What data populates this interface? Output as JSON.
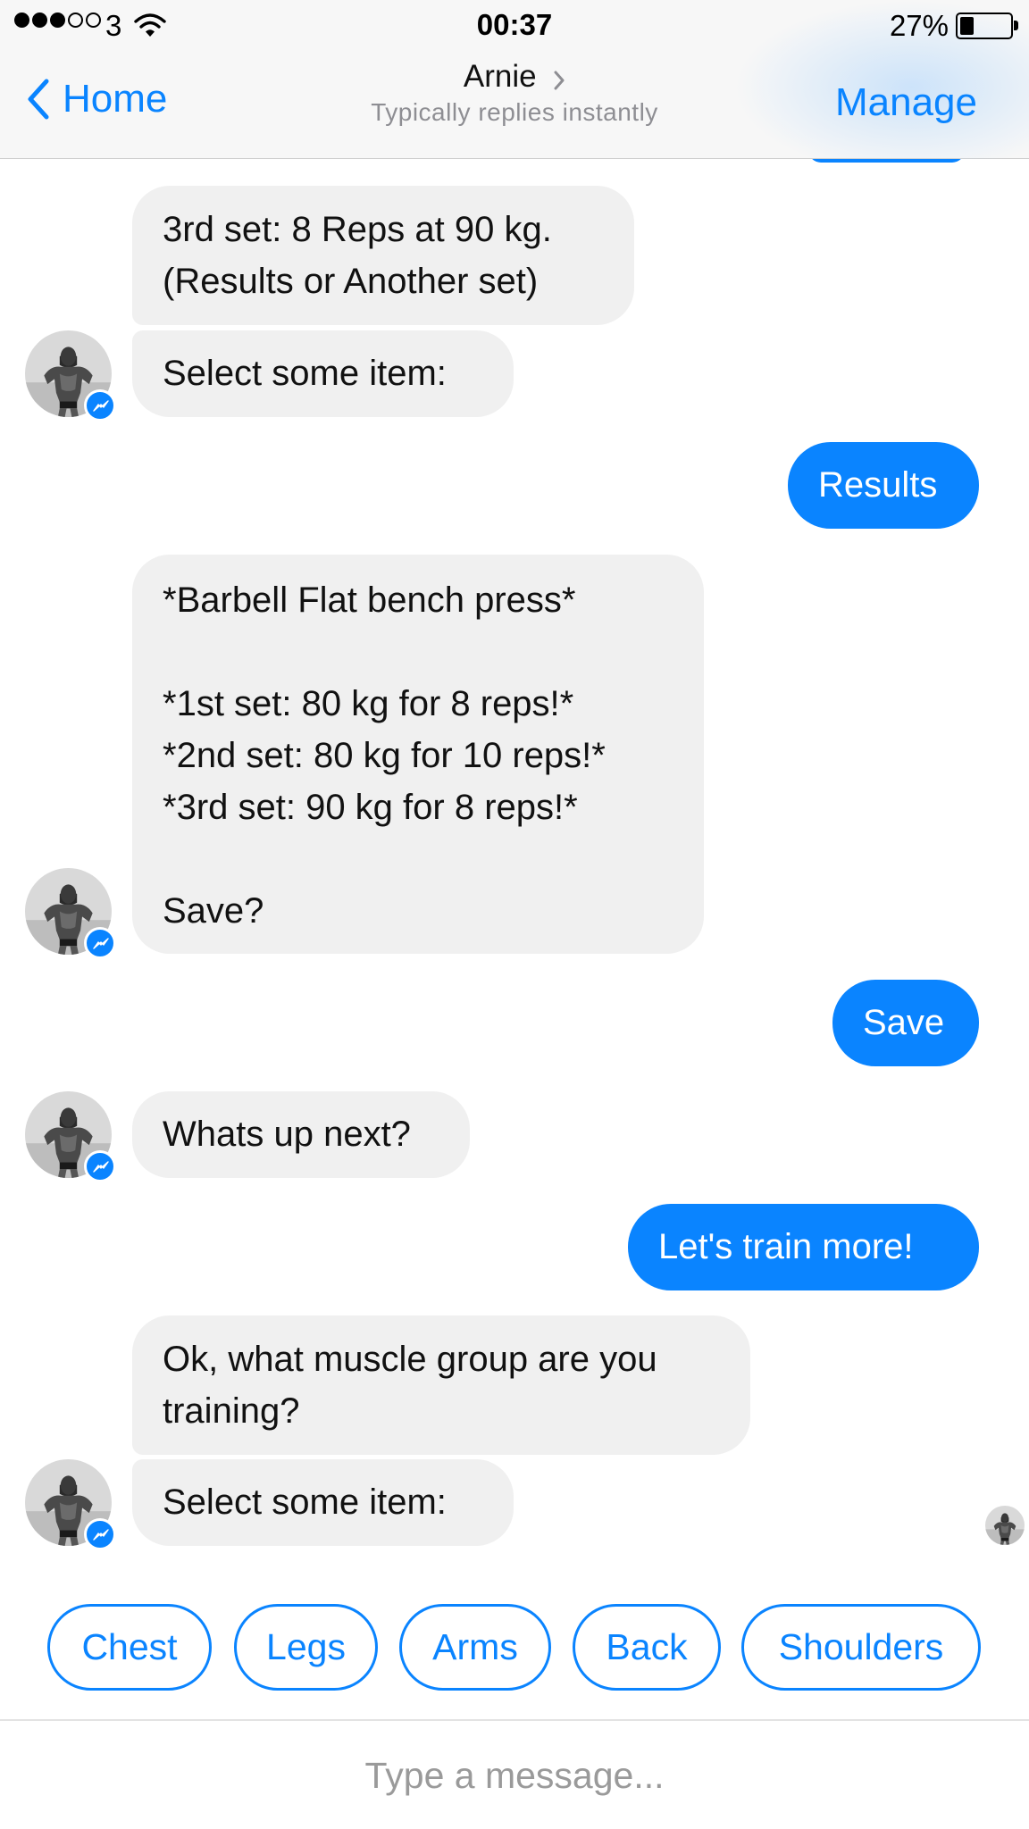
{
  "status_bar": {
    "carrier": "3",
    "time": "00:37",
    "battery_percent": "27%",
    "battery_level": 0.27,
    "signal_bars": 3,
    "signal_total": 5
  },
  "nav": {
    "back_label": "Home",
    "contact_name": "Arnie",
    "subtitle": "Typically replies instantly",
    "manage_label": "Manage"
  },
  "messages": [
    {
      "from": "bot",
      "text": "3rd set: 8 Reps at 90 kg.\n(Results or Another set)"
    },
    {
      "from": "bot",
      "text": "Select some item:"
    },
    {
      "from": "user",
      "text": "Results"
    },
    {
      "from": "bot",
      "text": "*Barbell Flat bench press*\n\n*1st set: 80 kg for 8 reps!*\n*2nd set: 80 kg for 10 reps!*\n*3rd set: 90 kg for 8 reps!*\n\nSave?"
    },
    {
      "from": "user",
      "text": "Save"
    },
    {
      "from": "bot",
      "text": "Whats up next?"
    },
    {
      "from": "user",
      "text": "Let's train more!"
    },
    {
      "from": "bot",
      "text": "Ok, what muscle group are you\ntraining?"
    },
    {
      "from": "bot",
      "text": "Select some item:"
    }
  ],
  "quick_replies": [
    "Chest",
    "Legs",
    "Arms",
    "Back",
    "Shoulders"
  ],
  "composer": {
    "placeholder": "Type a message..."
  },
  "colors": {
    "accent": "#0a84ff",
    "bot_bubble": "#f0f0f0",
    "user_bubble": "#0a84ff"
  },
  "icons": {
    "back": "chevron-left-icon",
    "contact_chevron": "chevron-right-icon",
    "wifi": "wifi-icon",
    "messenger_badge": "messenger-icon"
  }
}
